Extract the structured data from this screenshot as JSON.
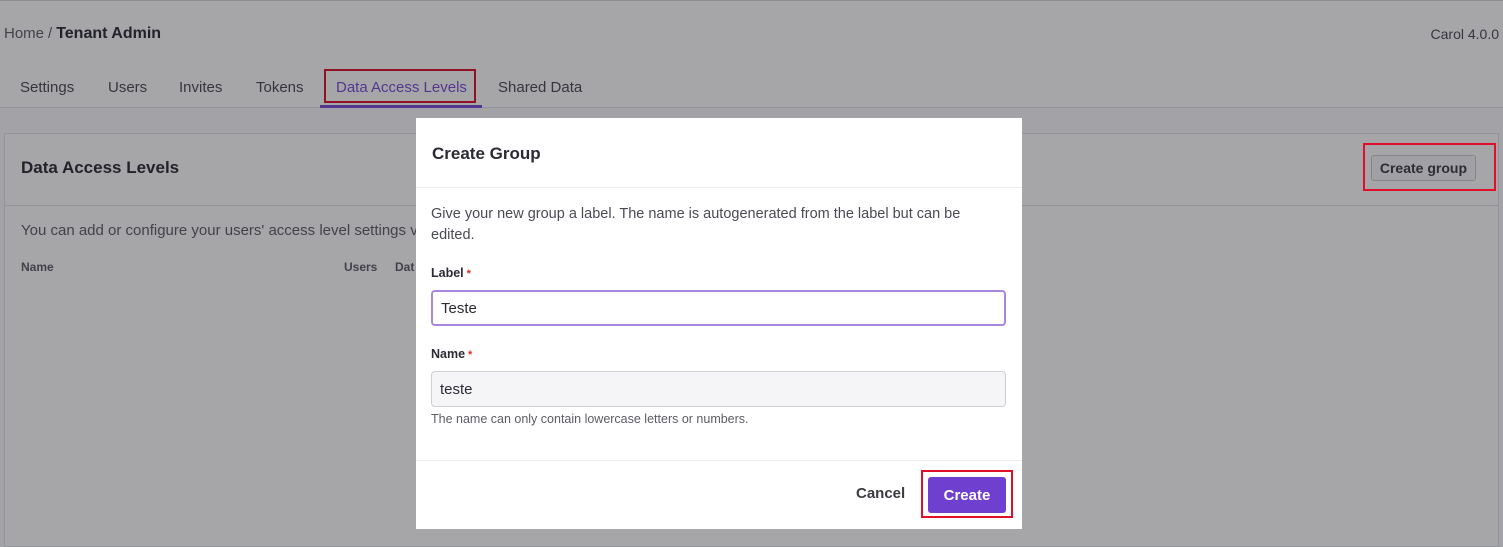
{
  "header": {
    "breadcrumb_home": "Home",
    "breadcrumb_sep": "/",
    "breadcrumb_current": "Tenant Admin",
    "version": "Carol 4.0.0"
  },
  "tabs": [
    {
      "label": "Settings"
    },
    {
      "label": "Users"
    },
    {
      "label": "Invites"
    },
    {
      "label": "Tokens"
    },
    {
      "label": "Data Access Levels",
      "active": true
    },
    {
      "label": "Shared Data"
    }
  ],
  "panel": {
    "title": "Data Access Levels",
    "create_group_label": "Create group",
    "description": "You can add or configure your users' access level settings v",
    "columns": [
      "Name",
      "Users",
      "Dat"
    ]
  },
  "modal": {
    "title": "Create Group",
    "description": "Give your new group a label. The name is autogenerated from the label but can be edited.",
    "label_field": {
      "label": "Label",
      "required_mark": "*",
      "value": "Teste"
    },
    "name_field": {
      "label": "Name",
      "required_mark": "*",
      "value": "teste",
      "hint": "The name can only contain lowercase letters or numbers."
    },
    "cancel_label": "Cancel",
    "create_label": "Create"
  },
  "colors": {
    "accent": "#6f3fd0",
    "active_tab": "#7b4bd6",
    "annotation": "#e0102a",
    "required": "#d6302b"
  }
}
